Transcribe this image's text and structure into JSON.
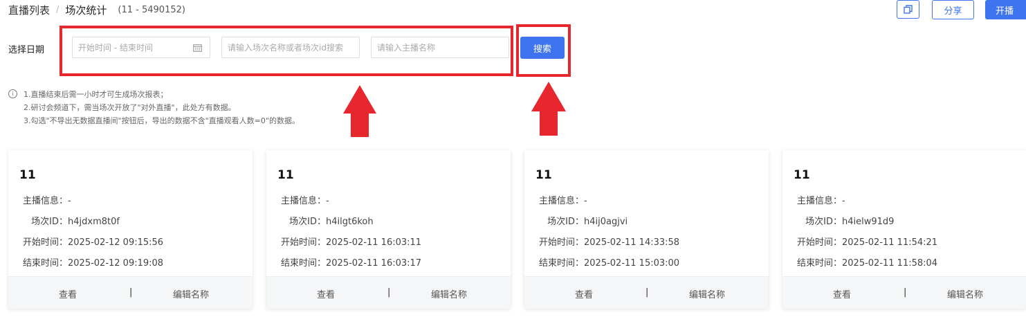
{
  "breadcrumb": {
    "root": "直播列表",
    "separator": "/",
    "current": "场次统计",
    "range": "(11 - 5490152)"
  },
  "top_actions": {
    "copy_icon": "copy-icon",
    "share_label": "分享",
    "live_label": "开播"
  },
  "filter": {
    "label": "选择日期",
    "date_placeholder": "开始时间 - 结束时间",
    "session_placeholder": "请输入场次名称或者场次id搜索",
    "anchor_placeholder": "请输入主播名称",
    "search_label": "搜索"
  },
  "tips": {
    "lines": [
      "1.直播结束后需一小时才可生成场次报表；",
      "2.研讨会频道下，需当场次开放了\"对外直播\"，此处方有数据。",
      "3.勾选\"不导出无数据直播间\"按钮后，导出的数据不含\"直播观看人数=0\"的数据。"
    ]
  },
  "card_labels": {
    "anchor": "主播信息：",
    "session_id": "场次ID：",
    "start": "开始时间：",
    "end": "结束时间：",
    "view": "查看",
    "divider": "|",
    "edit": "编辑名称"
  },
  "cards": [
    {
      "title": "11",
      "anchor": "-",
      "session_id": "h4jdxm8t0f",
      "start": "2025-02-12 09:15:56",
      "end": "2025-02-12 09:19:08"
    },
    {
      "title": "11",
      "anchor": "-",
      "session_id": "h4ilgt6koh",
      "start": "2025-02-11 16:03:11",
      "end": "2025-02-11 16:03:17"
    },
    {
      "title": "11",
      "anchor": "-",
      "session_id": "h4ij0agjvi",
      "start": "2025-02-11 14:33:58",
      "end": "2025-02-11 15:03:00"
    },
    {
      "title": "11",
      "anchor": "-",
      "session_id": "h4ielw91d9",
      "start": "2025-02-11 11:54:21",
      "end": "2025-02-11 11:58:04"
    }
  ],
  "colors": {
    "accent": "#3e74f0",
    "annotation_red": "#e8262d"
  }
}
